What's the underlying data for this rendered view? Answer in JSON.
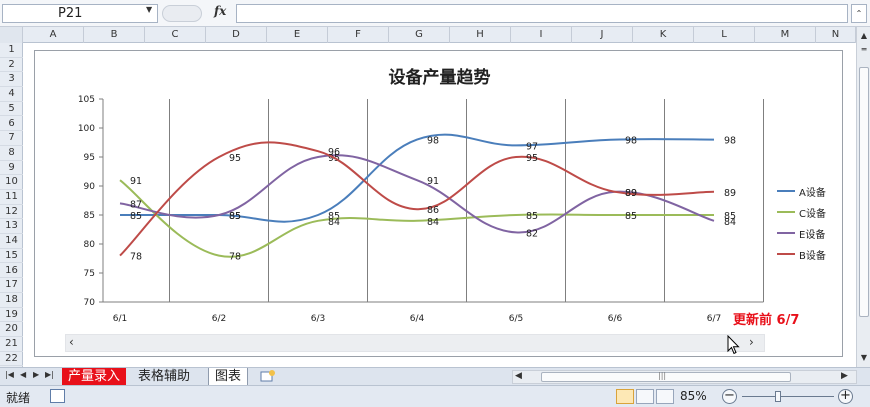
{
  "formula_bar": {
    "name_box_value": "P21",
    "fx_label": "fx",
    "formula_value": ""
  },
  "columns": [
    "A",
    "B",
    "C",
    "D",
    "E",
    "F",
    "G",
    "H",
    "I",
    "J",
    "K",
    "L",
    "M",
    "N"
  ],
  "rows": [
    "1",
    "2",
    "3",
    "4",
    "5",
    "6",
    "7",
    "8",
    "9",
    "10",
    "11",
    "12",
    "13",
    "14",
    "15",
    "16",
    "17",
    "18",
    "19",
    "20",
    "21",
    "22"
  ],
  "chart_data": {
    "type": "line",
    "title": "设备产量趋势",
    "categories": [
      "6/1",
      "6/2",
      "6/3",
      "6/4",
      "6/5",
      "6/6",
      "6/7"
    ],
    "ylim": [
      70,
      105
    ],
    "yticks": [
      "105",
      "100",
      "95",
      "90",
      "85",
      "80",
      "75",
      "70"
    ],
    "smooth": true,
    "grid": "vertical",
    "legend_position": "right",
    "series": [
      {
        "name": "A设备",
        "color": "#4a7ebb",
        "values": [
          85,
          85,
          85,
          98,
          97,
          98,
          98
        ],
        "labels": [
          "85",
          "85",
          "85",
          "98",
          "97",
          "98",
          "98"
        ]
      },
      {
        "name": "C设备",
        "color": "#9bbb59",
        "values": [
          91,
          78,
          84,
          84,
          85,
          85,
          85
        ],
        "labels": [
          "91",
          "78",
          "84",
          "84",
          "85",
          "85",
          "85"
        ]
      },
      {
        "name": "E设备",
        "color": "#8064a2",
        "values": [
          87,
          85,
          95,
          91,
          82,
          89,
          84
        ],
        "labels": [
          "87",
          "85",
          "95",
          "91",
          "82",
          "89",
          "84"
        ]
      },
      {
        "name": "B设备",
        "color": "#be4b48",
        "values": [
          78,
          95,
          96,
          86,
          95,
          89,
          89
        ],
        "labels": [
          "78",
          "95",
          "96",
          "86",
          "95",
          "89",
          "89"
        ]
      }
    ]
  },
  "update_note": "更新前 6/7",
  "sheet_tabs": [
    {
      "label": "产量录入"
    },
    {
      "label": "表格辅助"
    },
    {
      "label": "图表"
    }
  ],
  "status": {
    "ready_text": "就绪",
    "zoom": "85%"
  }
}
